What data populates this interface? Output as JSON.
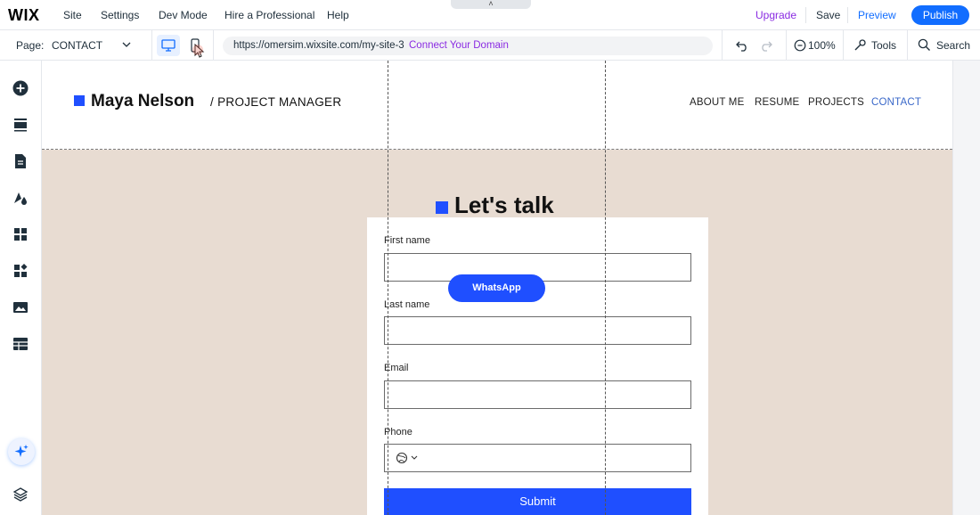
{
  "topbar": {
    "logo": "WIX",
    "menu": [
      "Site",
      "Settings",
      "Dev Mode",
      "Hire a Professional",
      "Help"
    ],
    "upgrade": "Upgrade",
    "save": "Save",
    "preview": "Preview",
    "publish": "Publish"
  },
  "toolbar": {
    "page_label": "Page:",
    "page_value": "CONTACT",
    "url": "https://omersim.wixsite.com/my-site-3",
    "connect_domain": "Connect Your Domain",
    "zoom": "100%",
    "tools": "Tools",
    "search": "Search"
  },
  "sidebar": {
    "icons": [
      "add-elements-icon",
      "sections-icon",
      "pages-icon",
      "design-icon",
      "apps-icon",
      "business-apps-icon",
      "media-icon",
      "cms-icon"
    ],
    "ai_icon": "ai-sparkle-icon",
    "layers_icon": "layers-icon"
  },
  "site": {
    "brand_name": "Maya Nelson",
    "brand_role": "/  PROJECT MANAGER",
    "nav": [
      {
        "label": "ABOUT ME",
        "active": false
      },
      {
        "label": "RESUME",
        "active": false
      },
      {
        "label": "PROJECTS",
        "active": false
      },
      {
        "label": "CONTACT",
        "active": true
      }
    ],
    "section_title": "Let's talk",
    "form": {
      "first_name_label": "First name",
      "last_name_label": "Last name",
      "email_label": "Email",
      "phone_label": "Phone",
      "submit_label": "Submit"
    },
    "whatsapp_label": "WhatsApp"
  },
  "colors": {
    "accent": "#116dff",
    "upgrade": "#8a2be2",
    "brand_blue": "#1f4fff",
    "section_bg": "#e8dcd2",
    "active_nav": "#3a68c9"
  }
}
